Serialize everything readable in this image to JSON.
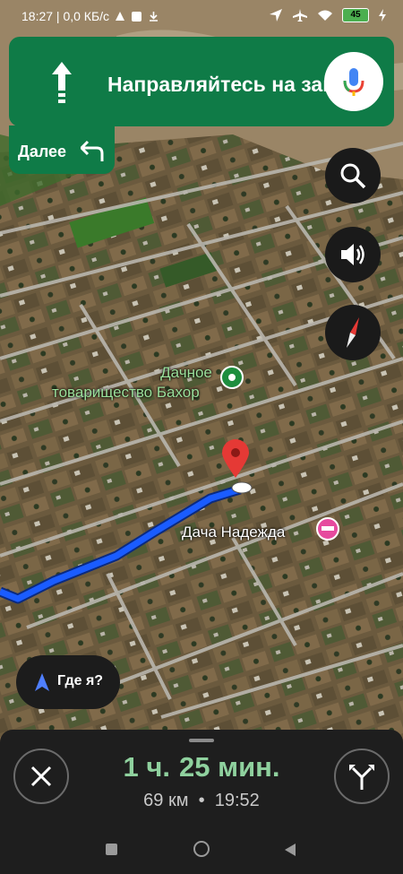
{
  "status_bar": {
    "time_info": "18:27 | 0,0 КБ/с",
    "battery": "45"
  },
  "navigation": {
    "instruction": "Направляйтесь на запад",
    "next_label": "Далее"
  },
  "map": {
    "places": [
      {
        "line1": "Дачное",
        "line2": "товарищество Бахор"
      },
      {
        "line1": "Дача Надежда"
      }
    ]
  },
  "where_button": "Где я?",
  "trip": {
    "hours": "1",
    "hours_unit": "ч.",
    "minutes": "25",
    "minutes_unit": "мин.",
    "distance": "69 км",
    "separator": "•",
    "arrival": "19:52"
  },
  "colors": {
    "banner": "#0f7b47",
    "route": "#1a5cff",
    "eta": "#8fd19e"
  }
}
